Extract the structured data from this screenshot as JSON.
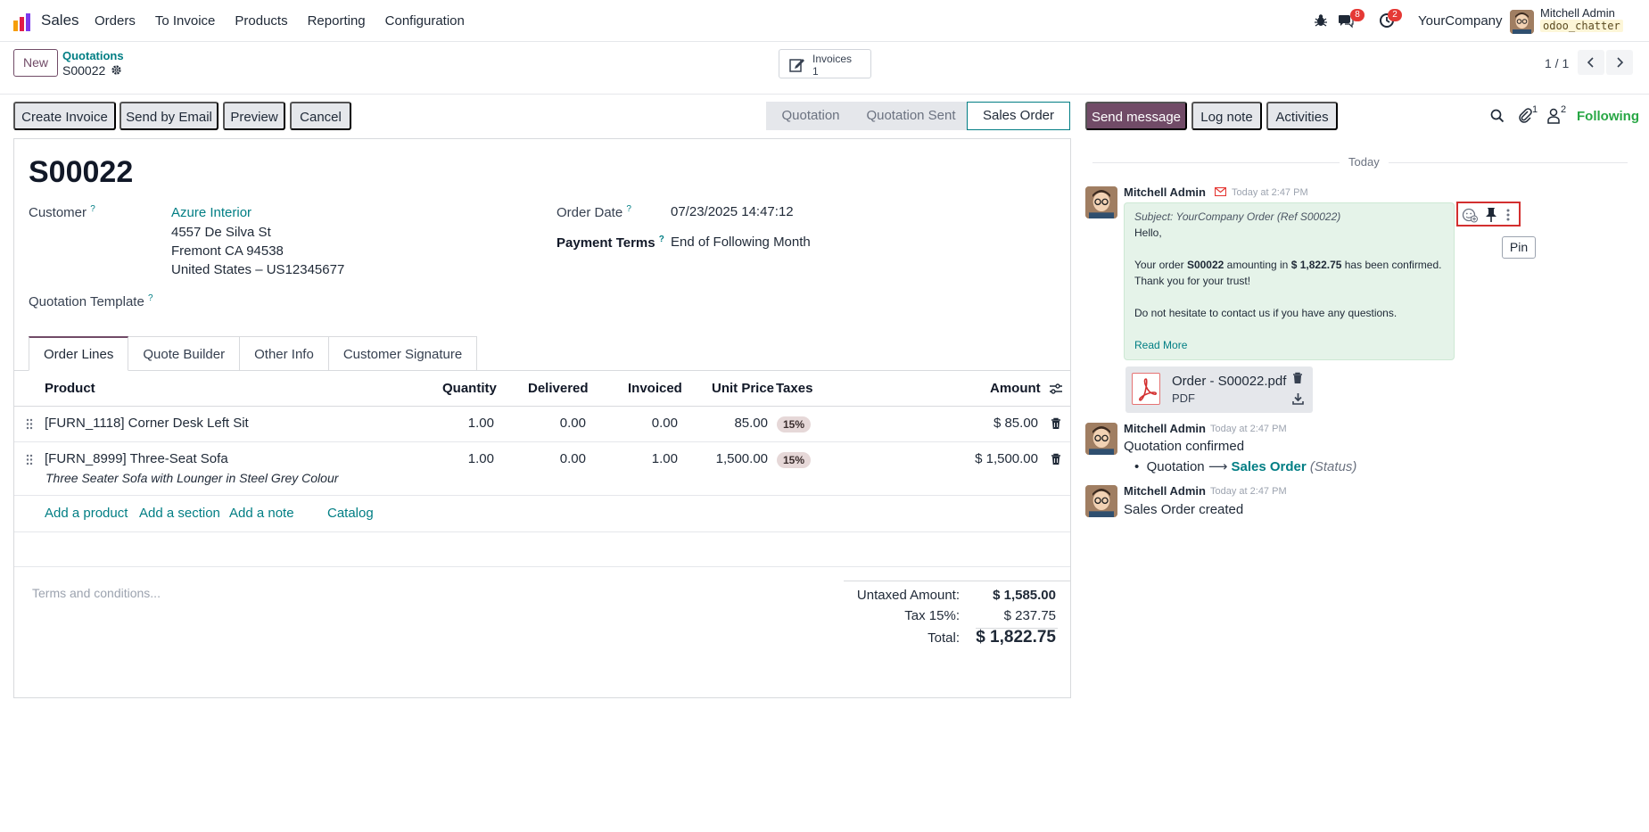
{
  "navbar": {
    "app_name": "Sales",
    "menu": [
      "Orders",
      "To Invoice",
      "Products",
      "Reporting",
      "Configuration"
    ],
    "messages_badge": "8",
    "activities_badge": "2",
    "company": "YourCompany",
    "user_name": "Mitchell Admin",
    "database": "odoo_chatter"
  },
  "control": {
    "new_label": "New",
    "breadcrumb_parent": "Quotations",
    "breadcrumb_current": "S00022",
    "smart_button_label": "Invoices",
    "smart_button_count": "1",
    "pager": "1 / 1"
  },
  "actions": {
    "create_invoice": "Create Invoice",
    "send_by_email": "Send by Email",
    "preview": "Preview",
    "cancel": "Cancel"
  },
  "status": {
    "stages": [
      "Quotation",
      "Quotation Sent",
      "Sales Order"
    ],
    "active": "Sales Order"
  },
  "form": {
    "title": "S00022",
    "customer_label": "Customer",
    "customer_name": "Azure Interior",
    "address_line1": "4557 De Silva St",
    "address_line2": "Fremont CA 94538",
    "address_line3": "United States – US12345677",
    "template_label": "Quotation Template",
    "order_date_label": "Order Date",
    "order_date": "07/23/2025 14:47:12",
    "payment_terms_label": "Payment Terms",
    "payment_terms": "End of Following Month",
    "help_mark": "?",
    "tabs": [
      "Order Lines",
      "Quote Builder",
      "Other Info",
      "Customer Signature"
    ]
  },
  "lines": {
    "headers": {
      "product": "Product",
      "quantity": "Quantity",
      "delivered": "Delivered",
      "invoiced": "Invoiced",
      "unit_price": "Unit Price",
      "taxes": "Taxes",
      "amount": "Amount"
    },
    "rows": [
      {
        "product": "[FURN_1118] Corner Desk Left Sit",
        "description": "",
        "quantity": "1.00",
        "delivered": "0.00",
        "invoiced": "0.00",
        "unit_price": "85.00",
        "tax": "15%",
        "amount": "$ 85.00"
      },
      {
        "product": "[FURN_8999] Three-Seat Sofa",
        "description": "Three Seater Sofa with Lounger in Steel Grey Colour",
        "quantity": "1.00",
        "delivered": "0.00",
        "invoiced": "1.00",
        "unit_price": "1,500.00",
        "tax": "15%",
        "amount": "$ 1,500.00"
      }
    ],
    "add_product": "Add a product",
    "add_section": "Add a section",
    "add_note": "Add a note",
    "catalog": "Catalog"
  },
  "totals": {
    "terms_placeholder": "Terms and conditions...",
    "untaxed_label": "Untaxed Amount:",
    "untaxed": "$ 1,585.00",
    "tax_label": "Tax 15%:",
    "tax": "$ 237.75",
    "total_label": "Total:",
    "total": "$ 1,822.75"
  },
  "chatter": {
    "send_message": "Send message",
    "log_note": "Log note",
    "activities": "Activities",
    "attachments_count": "1",
    "followers_count": "2",
    "following": "Following",
    "today": "Today",
    "messages": [
      {
        "author": "Mitchell Admin",
        "date": "Today at 2:47 PM",
        "subject": "Subject: YourCompany Order (Ref S00022)",
        "hello": "Hello,",
        "line1_pre": "Your order ",
        "line1_order": "S00022",
        "line1_mid": " amounting in ",
        "line1_amount": "$ 1,822.75",
        "line1_post": " has been confirmed.",
        "line2": "Thank you for your trust!",
        "line3": "Do not hesitate to contact us if you have any questions.",
        "read_more": "Read More",
        "attachment_name": "Order - S00022.pdf",
        "attachment_ext": "PDF"
      },
      {
        "author": "Mitchell Admin",
        "date": "Today at 2:47 PM",
        "text": "Quotation confirmed",
        "old_value": "Quotation",
        "new_value": "Sales Order",
        "field": "(Status)"
      },
      {
        "author": "Mitchell Admin",
        "date": "Today at 2:47 PM",
        "text": "Sales Order created"
      }
    ],
    "tooltip": "Pin"
  },
  "colors": {
    "brand": "#714b67",
    "link": "#017e84",
    "following": "#28a745",
    "badge": "#e53935",
    "highlight": "#d32f2f"
  }
}
